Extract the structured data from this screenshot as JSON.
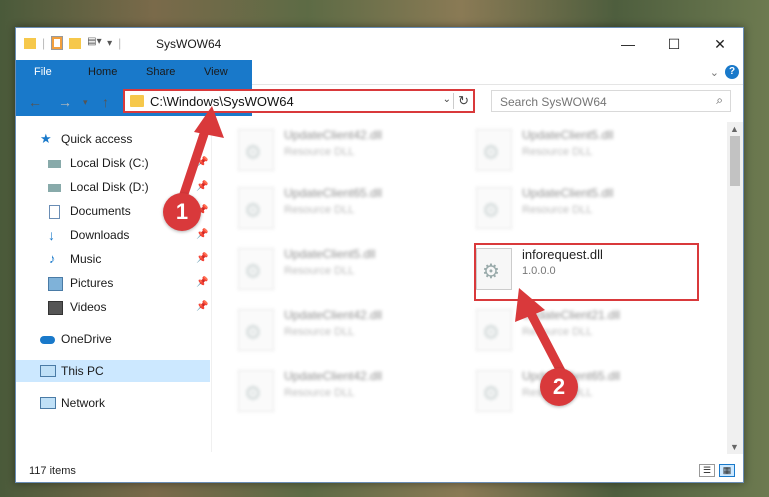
{
  "window": {
    "title": "SysWOW64",
    "controls": {
      "minimize": "—",
      "maximize": "☐",
      "close": "✕"
    }
  },
  "ribbon": {
    "tabs": [
      "File",
      "Home",
      "Share",
      "View"
    ],
    "collapse": "⌄",
    "help": "?"
  },
  "address": {
    "path": "C:\\Windows\\SysWOW64",
    "dropdown": "⌄",
    "refresh": "↻"
  },
  "search": {
    "placeholder": "Search SysWOW64",
    "icon": "search-icon"
  },
  "nav": {
    "quick_access": "Quick access",
    "items": [
      {
        "label": "Local Disk (C:)",
        "icon": "drive-icon",
        "pinned": true
      },
      {
        "label": "Local Disk (D:)",
        "icon": "drive-icon",
        "pinned": true
      },
      {
        "label": "Documents",
        "icon": "documents-icon",
        "pinned": true
      },
      {
        "label": "Downloads",
        "icon": "download-icon",
        "pinned": true
      },
      {
        "label": "Music",
        "icon": "music-icon",
        "pinned": true
      },
      {
        "label": "Pictures",
        "icon": "pictures-icon",
        "pinned": true
      },
      {
        "label": "Videos",
        "icon": "videos-icon",
        "pinned": true
      }
    ],
    "onedrive": "OneDrive",
    "this_pc": "This PC",
    "network": "Network"
  },
  "files": [
    {
      "name": "UpdateClient42.dll",
      "type": "Resource DLL"
    },
    {
      "name": "UpdateClient5.dll",
      "type": "Resource DLL"
    },
    {
      "name": "UpdateClient65.dll",
      "type": "Resource DLL"
    },
    {
      "name": "UpdateClient5.dll",
      "type": "Resource DLL"
    },
    {
      "name": "UpdateClient5.dll",
      "type": "Resource DLL"
    },
    {
      "name": "inforequest.dll",
      "type": "1.0.0.0"
    },
    {
      "name": "UpdateClient42.dll",
      "type": "Resource DLL"
    },
    {
      "name": "UpdateClient21.dll",
      "type": "Resource DLL"
    },
    {
      "name": "UpdateClient42.dll",
      "type": "Resource DLL"
    },
    {
      "name": "UpdateClient65.dll",
      "type": "Resource DLL"
    }
  ],
  "status": {
    "count": "117 items"
  },
  "annotations": {
    "step1": "1",
    "step2": "2"
  },
  "colors": {
    "accent": "#1979ca",
    "highlight": "#d9393b",
    "selection": "#cce8ff"
  }
}
